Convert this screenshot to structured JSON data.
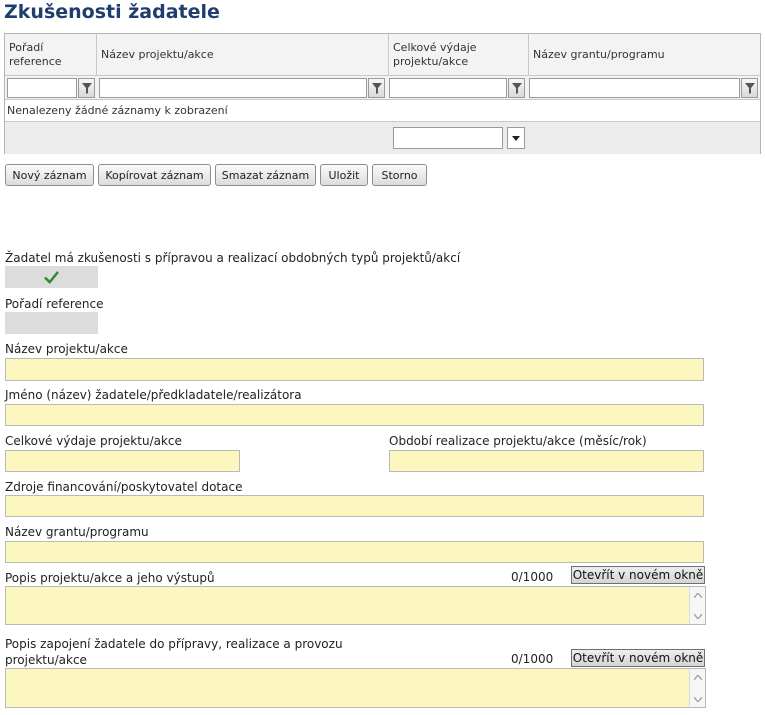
{
  "page_title": "Zkušenosti žadatele",
  "grid": {
    "columns": [
      "Pořadí reference",
      "Název projektu/akce",
      "Celkové výdaje projektu/akce",
      "Název grantu/programu"
    ],
    "empty_message": "Nenalezeny žádné záznamy k zobrazení"
  },
  "toolbar": {
    "new_label": "Nový záznam",
    "copy_label": "Kopírovat záznam",
    "delete_label": "Smazat záznam",
    "save_label": "Uložit",
    "cancel_label": "Storno"
  },
  "form": {
    "experience_label": "Žadatel má zkušenosti s přípravou a realizací obdobných typů projektů/akcí",
    "reference_order_label": "Pořadí reference",
    "project_name_label": "Název projektu/akce",
    "applicant_name_label": "Jméno (název) žadatele/předkladatele/realizátora",
    "total_costs_label": "Celkové výdaje projektu/akce",
    "period_label": "Období realizace projektu/akce (měsíc/rok)",
    "funding_source_label": "Zdroje financování/poskytovatel dotace",
    "grant_name_label": "Název grantu/programu",
    "description_label": "Popis projektu/akce a jeho výstupů",
    "description_counter": "0/1000",
    "involvement_label_line1": "Popis zapojení žadatele do přípravy, realizace a provozu",
    "involvement_label_line2": "projektu/akce",
    "involvement_counter": "0/1000",
    "open_window_label": "Otevřít v novém okně"
  },
  "colors": {
    "title": "#1f3d6d",
    "field_yellow": "#fcf6bf",
    "readonly_gray": "#dcdcdc",
    "checkmark": "#2f8a2f"
  }
}
